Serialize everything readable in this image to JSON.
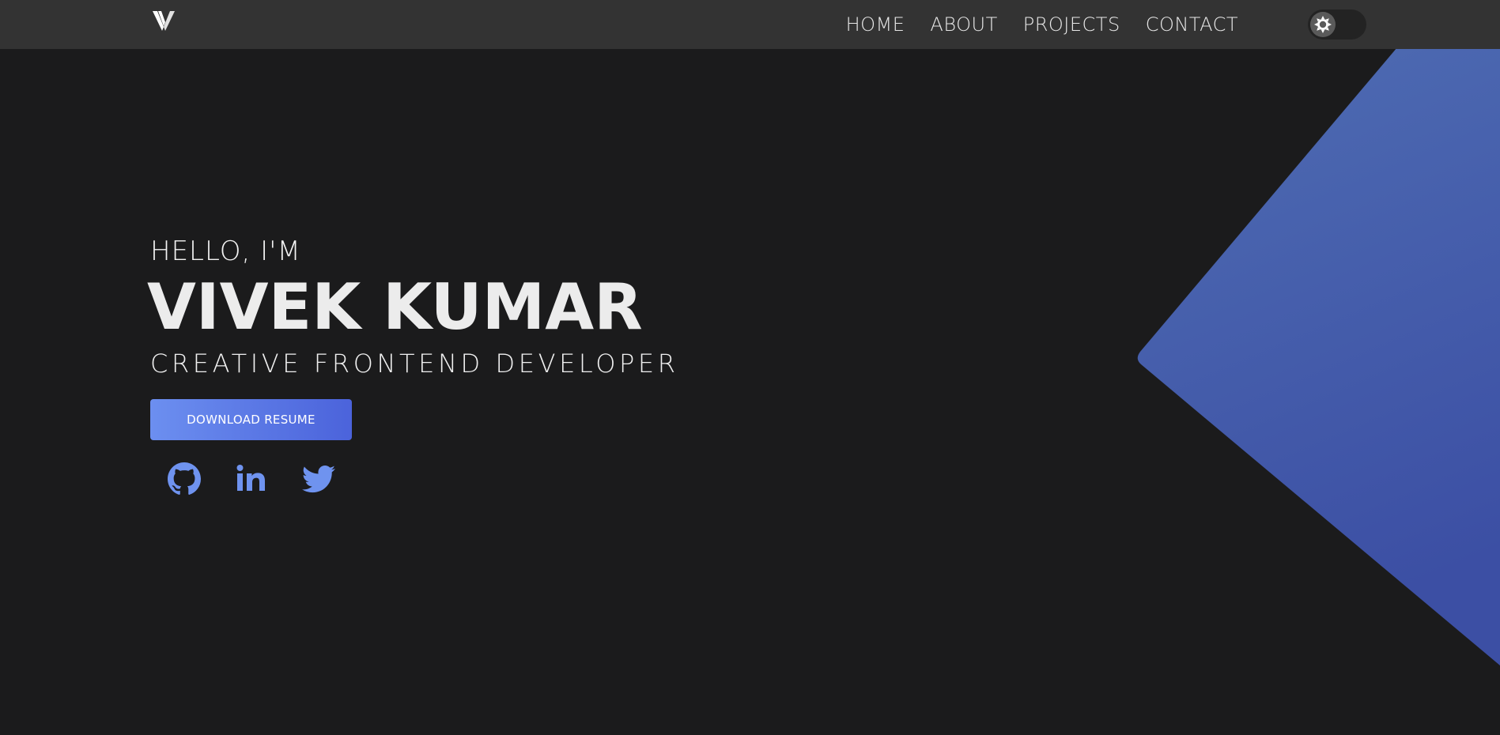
{
  "nav": {
    "logo_icon": "v-logo-icon",
    "links": [
      {
        "label": "HOME"
      },
      {
        "label": "ABOUT"
      },
      {
        "label": "PROJECTS"
      },
      {
        "label": "CONTACT"
      }
    ],
    "theme_toggle": {
      "icon": "sun-icon",
      "state": "dark"
    }
  },
  "hero": {
    "greeting": "HELLO, I'M",
    "name": "VIVEK KUMAR",
    "role": "CREATIVE FRONTEND DEVELOPER",
    "resume_button": "DOWNLOAD RESUME",
    "socials": [
      {
        "icon": "github-icon"
      },
      {
        "icon": "linkedin-icon"
      },
      {
        "icon": "twitter-icon"
      }
    ]
  },
  "colors": {
    "background": "#1b1b1c",
    "navbar": "#333333",
    "accent": "#5b79e6",
    "accent_gradient_start": "#6c8ff0",
    "accent_gradient_end": "#4b63db",
    "diamond_top": "#4f6db3",
    "diamond_bottom": "#3c4fa4"
  }
}
